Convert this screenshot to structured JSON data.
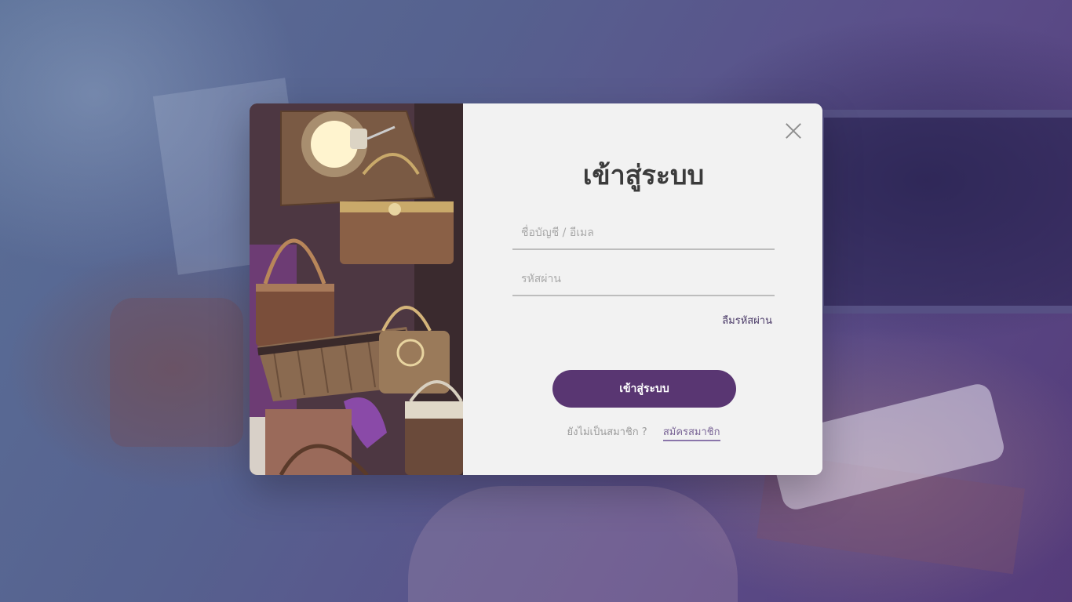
{
  "modal": {
    "title": "เข้าสู่ระบบ",
    "username_placeholder": "ชื่อบัญชี / อีเมล",
    "password_placeholder": "รหัสผ่าน",
    "forgot_password_label": "ลืมรหัสผ่าน",
    "login_button_label": "เข้าสู่ระบบ",
    "signup_question": "ยังไม่เป็นสมาชิก ?",
    "signup_link_label": "สมัครสมาชิก",
    "close_icon": "close-icon"
  },
  "colors": {
    "primary": "#593672",
    "panel_background": "#f2f2f2",
    "title_text": "#3b3b3b",
    "link": "#7a6596"
  }
}
